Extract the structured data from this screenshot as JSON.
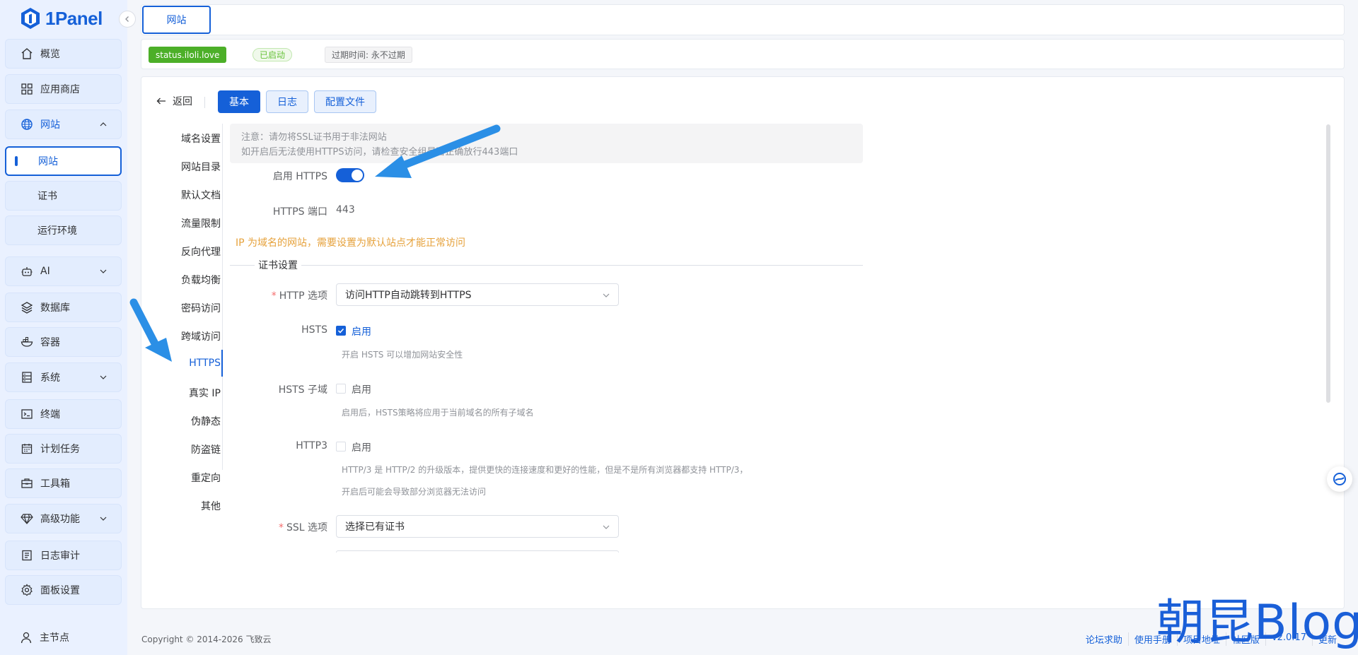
{
  "app": {
    "name": "1Panel"
  },
  "sidebar": {
    "items": [
      {
        "label": "概览",
        "icon": "home-icon"
      },
      {
        "label": "应用商店",
        "icon": "grid-icon"
      },
      {
        "label": "网站",
        "icon": "globe-icon",
        "expanded": true,
        "children": [
          {
            "label": "网站",
            "active": true
          },
          {
            "label": "证书"
          },
          {
            "label": "运行环境"
          }
        ]
      },
      {
        "label": "AI",
        "icon": "robot-icon"
      },
      {
        "label": "数据库",
        "icon": "layers-icon"
      },
      {
        "label": "容器",
        "icon": "container-icon"
      },
      {
        "label": "系统",
        "icon": "server-icon"
      },
      {
        "label": "终端",
        "icon": "terminal-icon"
      },
      {
        "label": "计划任务",
        "icon": "calendar-icon"
      },
      {
        "label": "工具箱",
        "icon": "toolbox-icon"
      },
      {
        "label": "高级功能",
        "icon": "diamond-icon"
      },
      {
        "label": "日志审计",
        "icon": "log-icon"
      },
      {
        "label": "面板设置",
        "icon": "gear-icon"
      }
    ],
    "node": {
      "label": "主节点",
      "icon": "user-icon"
    }
  },
  "tabs": {
    "active": "网站"
  },
  "site": {
    "domain": "status.iloli.love",
    "status": "已启动",
    "expire": "过期时间: 永不过期"
  },
  "toolbar": {
    "back": "返回",
    "buttons": [
      "基本",
      "日志",
      "配置文件"
    ]
  },
  "leftnav": [
    "域名设置",
    "网站目录",
    "默认文档",
    "流量限制",
    "反向代理",
    "负载均衡",
    "密码访问",
    "跨域访问",
    "HTTPS",
    "真实 IP",
    "伪静态",
    "防盗链",
    "重定向",
    "其他"
  ],
  "https": {
    "notice_line1": "注意：请勿将SSL证书用于非法网站",
    "notice_line2": "如开启后无法使用HTTPS访问，请检查安全组是否正确放行443端口",
    "enable_label": "启用 HTTPS",
    "enabled": true,
    "port_label": "HTTPS 端口",
    "port": "443",
    "ip_warning": "IP 为域名的网站，需要设置为默认站点才能正常访问",
    "cert_section": "证书设置",
    "http_option_label": "HTTP 选项",
    "http_option_value": "访问HTTP自动跳转到HTTPS",
    "hsts_label": "HSTS",
    "hsts_check": "启用",
    "hsts_checked": true,
    "hsts_help": "开启 HSTS 可以增加网站安全性",
    "hsts_sub_label": "HSTS 子域",
    "hsts_sub_check": "启用",
    "hsts_sub_help": "启用后，HSTS策略将应用于当前域名的所有子域名",
    "http3_label": "HTTP3",
    "http3_check": "启用",
    "http3_help1": "HTTP/3 是 HTTP/2 的升级版本，提供更快的连接速度和更好的性能，但是不是所有浏览器都支持 HTTP/3，",
    "http3_help2": "开启后可能会导致部分浏览器无法访问",
    "ssl_label": "SSL 选项",
    "ssl_value": "选择已有证书"
  },
  "footer": {
    "copyright": "Copyright © 2014-2026 飞致云",
    "links": [
      "论坛求助",
      "使用手册",
      "项目地址",
      "社区版",
      "v2.0.17",
      "更新"
    ]
  },
  "watermark": "朝昆Blog",
  "colors": {
    "primary": "#1560d8",
    "success": "#4caf28",
    "warning": "#e6a23c",
    "annotation_arrow": "#2b8fe6"
  }
}
